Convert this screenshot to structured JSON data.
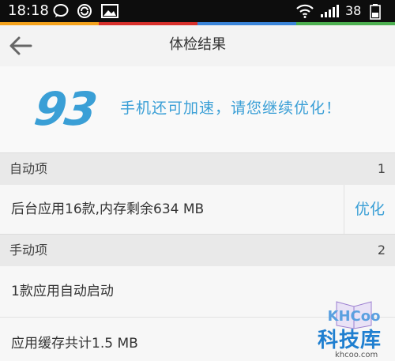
{
  "status_bar": {
    "time": "18:18",
    "battery_level": "38",
    "icons": [
      "chat-bubble-icon",
      "sync-icon",
      "image-icon",
      "wifi-icon",
      "signal-icon",
      "battery-icon"
    ]
  },
  "header": {
    "title": "体检结果",
    "back_icon": "arrow-left-icon"
  },
  "score_panel": {
    "score": "93",
    "message": "手机还可加速，请您继续优化！"
  },
  "sections": {
    "auto": {
      "label": "自动项",
      "count": "1"
    },
    "manual": {
      "label": "手动项",
      "count": "2"
    }
  },
  "auto_items": [
    {
      "label": "后台应用16款,内存剩余634 MB",
      "action": "优化"
    }
  ],
  "manual_items": [
    {
      "label": "1款应用自动启动"
    },
    {
      "label": "应用缓存共计1.5 MB"
    }
  ],
  "watermark": {
    "logo_text": "KHCoo",
    "name": "科技库",
    "site": "khcoo.com"
  },
  "colors": {
    "accent": "#3a9fd6",
    "stripe": [
      "#f4a21c",
      "#d7302b",
      "#3a84d8",
      "#4caf50"
    ]
  }
}
